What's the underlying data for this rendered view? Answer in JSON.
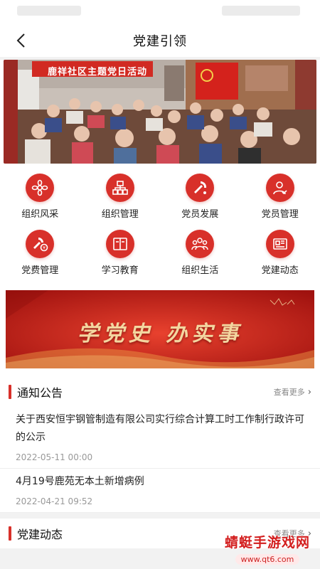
{
  "nav": {
    "title": "党建引领"
  },
  "banner": {
    "caption": "鹿祥社区主题党日活动"
  },
  "grid": [
    {
      "label": "组织风采",
      "icon": "flower-icon"
    },
    {
      "label": "组织管理",
      "icon": "org-chart-icon"
    },
    {
      "label": "党员发展",
      "icon": "party-emblem-icon"
    },
    {
      "label": "党员管理",
      "icon": "user-manage-icon"
    },
    {
      "label": "党费管理",
      "icon": "party-fee-icon"
    },
    {
      "label": "学习教育",
      "icon": "book-icon"
    },
    {
      "label": "组织生活",
      "icon": "group-icon"
    },
    {
      "label": "党建动态",
      "icon": "newspaper-icon"
    }
  ],
  "promo": {
    "text": "学党史 办实事"
  },
  "notices": {
    "title": "通知公告",
    "more": "查看更多",
    "items": [
      {
        "title": "关于西安恒宇钢管制造有限公司实行综合计算工时工作制行政许可的公示",
        "date": "2022-05-11 00:00"
      },
      {
        "title": "4月19号鹿苑无本土新增病例",
        "date": "2022-04-21 09:52"
      }
    ]
  },
  "dynamics": {
    "title": "党建动态",
    "more": "查看更多"
  },
  "watermark": {
    "main": "蜻蜓手游戏网",
    "url": "www.qt6.com"
  },
  "colors": {
    "accent": "#d8302a",
    "promo_bg": "#c0201c",
    "promo_text": "#f3d6a0"
  }
}
